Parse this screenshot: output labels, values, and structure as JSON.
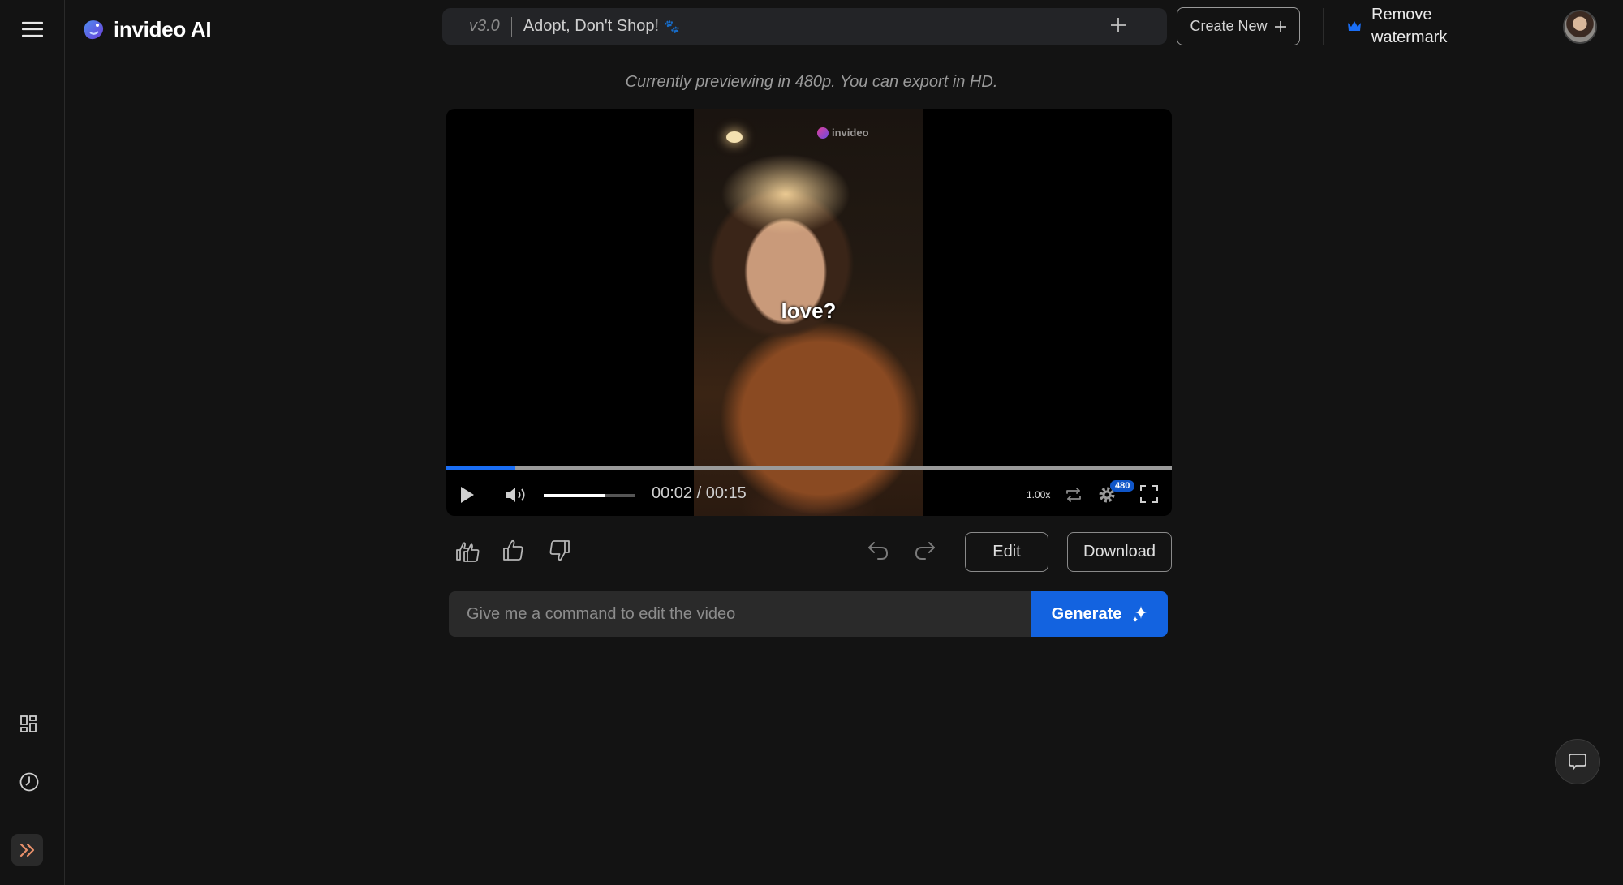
{
  "app": {
    "name": "invideo AI"
  },
  "header": {
    "menu_icon": "hamburger-icon",
    "project": {
      "version": "v3.0",
      "title": "Adopt, Don't Shop!",
      "emoji_icon": "paw-prints-icon",
      "add_icon": "plus-icon"
    },
    "create_new_label": "Create New",
    "remove_watermark_label": "Remove watermark",
    "remove_watermark_icon": "crown-icon",
    "accent_color": "#1a6ef5"
  },
  "preview_note": "Currently previewing in 480p. You can export in HD.",
  "player": {
    "watermark": "invideo",
    "caption": "love?",
    "progress_fraction": 0.095,
    "volume_fraction": 0.66,
    "current_time": "00:02",
    "duration": "00:15",
    "time_display": "00:02 / 00:15",
    "speed": "1.00x",
    "resolution_badge": "480"
  },
  "actions": {
    "edit_label": "Edit",
    "download_label": "Download"
  },
  "command": {
    "placeholder": "Give me a command to edit the video",
    "value": "",
    "generate_label": "Generate"
  },
  "colors": {
    "primary": "#1363e0",
    "expand_accent": "#e8906a"
  }
}
